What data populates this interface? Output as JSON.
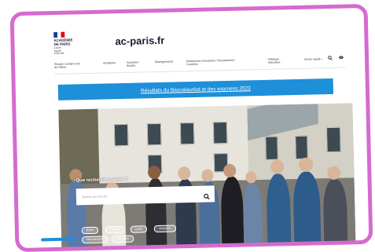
{
  "logo": {
    "line1": "ACADÉMIE",
    "line2": "DE PARIS",
    "motto": [
      "Liberté",
      "Égalité",
      "Fraternité"
    ]
  },
  "site_title": "ac-paris.fr",
  "nav": {
    "items": [
      "Réussir scolaire tout de l'élève",
      "Académie",
      "Scolarité / Études",
      "Enseignement",
      "Ressources Humaines / Recrutement / Carrières",
      "Politique éducative"
    ],
    "extra": "Accès rapide",
    "extra_icon": "chevron-down-icon",
    "search_icon": "search-icon",
    "account_icon": "eye-icon"
  },
  "banner": {
    "text": "Résultats du Baccalauréat et des examens 2023",
    "color": "#1e8fd9"
  },
  "search": {
    "label": "Que recherchez-vous ?",
    "placeholder": "Entrez un mot-clé",
    "icon": "search-icon"
  },
  "chips": [
    "École",
    "Collège",
    "Lycée",
    "Journalier",
    "Recrutement",
    "Formation"
  ],
  "colors": {
    "frame": "#d66ad0",
    "accent": "#1e8fd9",
    "text": "#1b1b35"
  }
}
